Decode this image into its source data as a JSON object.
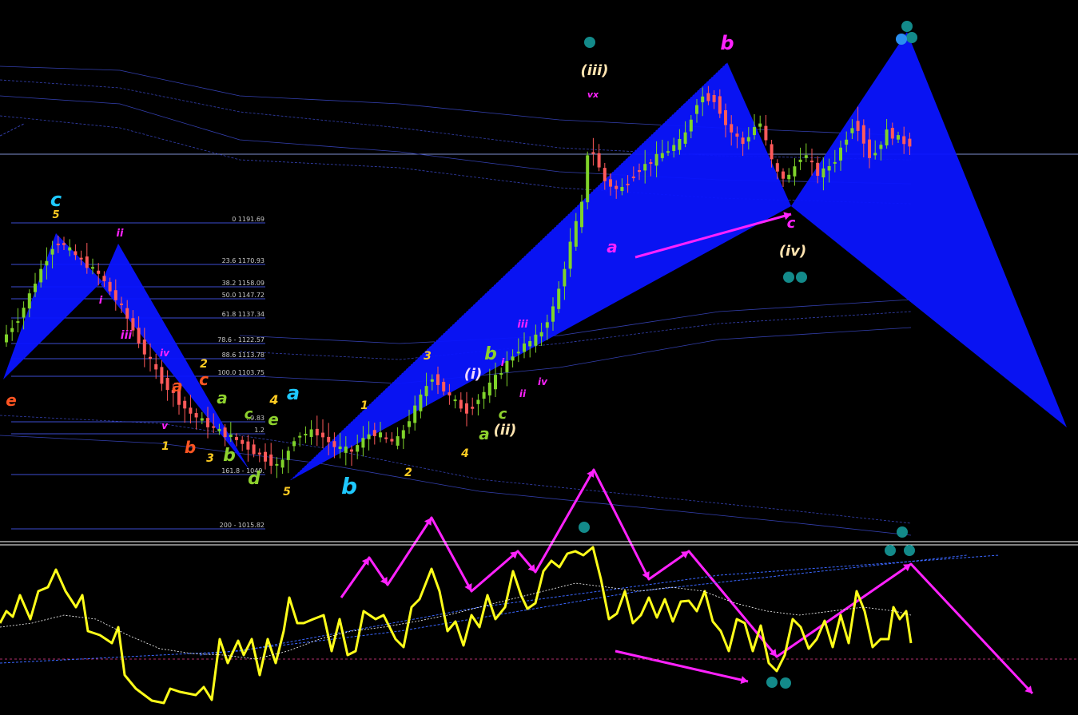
{
  "colors": {
    "background": "#000000",
    "bull_candle": "#7fd32a",
    "bear_candle": "#ff5a5a",
    "harmonic_fill": "#0a14ff",
    "oscillator": "#ffff1a",
    "arrow": "#ff22ff",
    "fib_line": "#3b4bd0",
    "dot": "#138a8a",
    "dot_alt": "#2a8ff0"
  },
  "chart_data": {
    "type": "candlestick",
    "price_panel": {
      "fib_levels": [
        {
          "level": "0",
          "price": "1191.69",
          "text": "0 1191.69"
        },
        {
          "level": "23.6",
          "price": "1170.93",
          "text": "23.6 1170.93"
        },
        {
          "level": "38.2",
          "price": "1158.09",
          "text": "38.2 1158.09"
        },
        {
          "level": "50.0",
          "price": "1147.72",
          "text": "50.0 1147.72"
        },
        {
          "level": "61.8",
          "price": "1137.34",
          "text": "61.8 1137.34"
        },
        {
          "level": "78.6",
          "price": "1122.57",
          "text": "78.6 - 1122.57"
        },
        {
          "level": "88.6",
          "price": "1113.78",
          "text": "88.6 1113.78"
        },
        {
          "level": "100.0",
          "price": "1103.75",
          "text": "100.0 1103.75"
        },
        {
          "level": "127.2",
          "price": "",
          "text": "..9.83"
        },
        {
          "level": "138.2",
          "price": "",
          "text": "1.2"
        },
        {
          "level": "161.8",
          "price": "1049.",
          "text": "161.8 - 1049."
        },
        {
          "level": "200",
          "price": "1015.82",
          "text": "200 - 1015.82"
        }
      ],
      "wave_labels": [
        {
          "text": "c",
          "color": "#1ec8ff"
        },
        {
          "text": "5",
          "color": "#ffcc22"
        },
        {
          "text": "ii",
          "color": "#ff22ff"
        },
        {
          "text": "i",
          "color": "#ff22ff"
        },
        {
          "text": "iii",
          "color": "#ff22ff"
        },
        {
          "text": "iv",
          "color": "#ff22ff"
        },
        {
          "text": "v",
          "color": "#ff22ff"
        },
        {
          "text": "e",
          "color": "#ff5522"
        },
        {
          "text": "a",
          "color": "#ff5522"
        },
        {
          "text": "c",
          "color": "#ff5522"
        },
        {
          "text": "b",
          "color": "#ff5522"
        },
        {
          "text": "1",
          "color": "#ffcc22"
        },
        {
          "text": "2",
          "color": "#ffcc22"
        },
        {
          "text": "3",
          "color": "#ffcc22"
        },
        {
          "text": "a",
          "color": "#8ed12e"
        },
        {
          "text": "b",
          "color": "#8ed12e"
        },
        {
          "text": "c",
          "color": "#8ed12e"
        },
        {
          "text": "d",
          "color": "#8ed12e"
        },
        {
          "text": "e",
          "color": "#8ed12e"
        },
        {
          "text": "4",
          "color": "#ffcc22"
        },
        {
          "text": "a",
          "color": "#1ec8ff"
        },
        {
          "text": "5",
          "color": "#ffcc22"
        },
        {
          "text": "b",
          "color": "#1ec8ff"
        },
        {
          "text": "1",
          "color": "#ffcc22"
        },
        {
          "text": "2",
          "color": "#ffcc22"
        },
        {
          "text": "3",
          "color": "#ffcc22"
        },
        {
          "text": "4",
          "color": "#ffcc22"
        },
        {
          "text": "(i)",
          "color": "#f0d8ff"
        },
        {
          "text": "b",
          "color": "#8ed12e"
        },
        {
          "text": "i",
          "color": "#ff22ff"
        },
        {
          "text": "c",
          "color": "#8ed12e"
        },
        {
          "text": "a",
          "color": "#8ed12e"
        },
        {
          "text": "(ii)",
          "color": "#ffe4b0"
        },
        {
          "text": "ii",
          "color": "#ff22ff"
        },
        {
          "text": "iii",
          "color": "#ff22ff"
        },
        {
          "text": "iv",
          "color": "#ff22ff"
        },
        {
          "text": "(iii)",
          "color": "#ffe4b0"
        },
        {
          "text": "vx",
          "color": "#ff22ff"
        },
        {
          "text": "a",
          "color": "#ff22ff"
        },
        {
          "text": "b",
          "color": "#ff22ff"
        },
        {
          "text": "c",
          "color": "#ff22ff"
        },
        {
          "text": "(iv)",
          "color": "#ffe4b0"
        }
      ]
    },
    "oscillator_panel": {
      "series": [
        {
          "role": "oscillator",
          "color": "#ffff1a"
        },
        {
          "role": "signal",
          "color": "#ffffff"
        }
      ]
    }
  }
}
